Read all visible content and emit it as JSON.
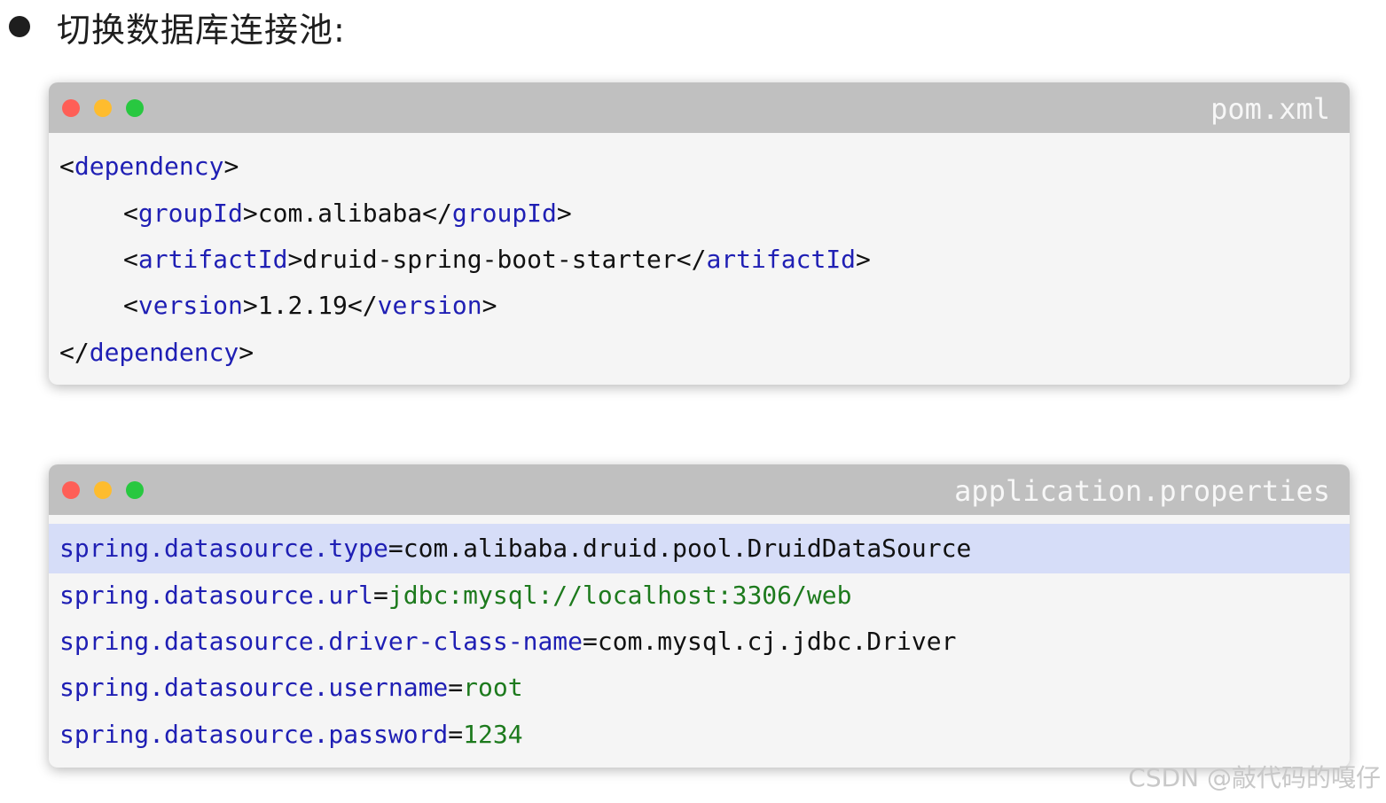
{
  "heading": {
    "text": "切换数据库连接池:"
  },
  "pom_window": {
    "filename": "pom.xml",
    "lines": [
      {
        "open": "<",
        "tag": "dependency",
        "close": ">"
      },
      {
        "lt1": "<",
        "tag1": "groupId",
        "gt1": ">",
        "text": "com.alibaba",
        "lt2": "</",
        "tag2": "groupId",
        "gt2": ">"
      },
      {
        "lt1": "<",
        "tag1": "artifactId",
        "gt1": ">",
        "text": "druid-spring-boot-starter",
        "lt2": "</",
        "tag2": "artifactId",
        "gt2": ">"
      },
      {
        "lt1": "<",
        "tag1": "version",
        "gt1": ">",
        "text": "1.2.19",
        "lt2": "</",
        "tag2": "version",
        "gt2": ">"
      },
      {
        "open": "</",
        "tag": "dependency",
        "close": ">"
      }
    ]
  },
  "props_window": {
    "filename": "application.properties",
    "lines": [
      {
        "key": "spring.datasource.type",
        "eq": "=",
        "value": "com.alibaba.druid.pool.DruidDataSource"
      },
      {
        "key": "spring.datasource.url",
        "eq": "=",
        "value": "jdbc:mysql://localhost:3306/web"
      },
      {
        "key": "spring.datasource.driver-class-name",
        "eq": "=",
        "value": "com.mysql.cj.jdbc.Driver"
      },
      {
        "key": "spring.datasource.username",
        "eq": "=",
        "value": "root"
      },
      {
        "key": "spring.datasource.password",
        "eq": "=",
        "value": "1234"
      }
    ]
  },
  "watermark": "CSDN @敲代码的嘎仔",
  "colors": {
    "tag": "#1f1fb4",
    "value_green": "#1d7a1d",
    "highlight": "#d6ddf8",
    "titlebar": "#c0c0c0"
  }
}
